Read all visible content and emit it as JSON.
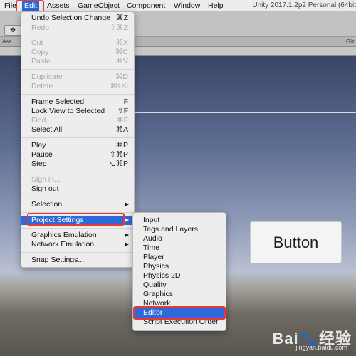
{
  "menubar": {
    "items": [
      {
        "label": "File"
      },
      {
        "label": "Edit"
      },
      {
        "label": "Assets"
      },
      {
        "label": "GameObject"
      },
      {
        "label": "Component"
      },
      {
        "label": "Window"
      },
      {
        "label": "Help"
      }
    ],
    "title": "Unity 2017.1.2p2 Personal (64bit"
  },
  "toolbar": {
    "tabs": {
      "assets": "Ass",
      "gizmos": "Giz"
    }
  },
  "edit_menu": {
    "items": [
      {
        "label": "Undo Selection Change",
        "shortcut": "⌘Z",
        "disabled": false
      },
      {
        "label": "Redo",
        "shortcut": "⇧⌘Z",
        "disabled": true
      },
      {
        "label": "Cut",
        "shortcut": "⌘X",
        "disabled": true
      },
      {
        "label": "Copy",
        "shortcut": "⌘C",
        "disabled": true
      },
      {
        "label": "Paste",
        "shortcut": "⌘V",
        "disabled": true
      },
      {
        "label": "Duplicate",
        "shortcut": "⌘D",
        "disabled": true
      },
      {
        "label": "Delete",
        "shortcut": "⌘⌫",
        "disabled": true
      },
      {
        "label": "Frame Selected",
        "shortcut": "F",
        "disabled": false
      },
      {
        "label": "Lock View to Selected",
        "shortcut": "⇧F",
        "disabled": false
      },
      {
        "label": "Find",
        "shortcut": "⌘F",
        "disabled": true
      },
      {
        "label": "Select All",
        "shortcut": "⌘A",
        "disabled": false
      },
      {
        "label": "Play",
        "shortcut": "⌘P",
        "disabled": false
      },
      {
        "label": "Pause",
        "shortcut": "⇧⌘P",
        "disabled": false
      },
      {
        "label": "Step",
        "shortcut": "⌥⌘P",
        "disabled": false
      },
      {
        "label": "Sign in...",
        "shortcut": "",
        "disabled": true
      },
      {
        "label": "Sign out",
        "shortcut": "",
        "disabled": false
      },
      {
        "label": "Selection",
        "shortcut": "",
        "disabled": false
      },
      {
        "label": "Project Settings",
        "shortcut": "",
        "disabled": false,
        "highlighted": true
      },
      {
        "label": "Graphics Emulation",
        "shortcut": "",
        "disabled": false
      },
      {
        "label": "Network Emulation",
        "shortcut": "",
        "disabled": false
      },
      {
        "label": "Snap Settings...",
        "shortcut": "",
        "disabled": false
      }
    ]
  },
  "project_settings_submenu": {
    "items": [
      {
        "label": "Input"
      },
      {
        "label": "Tags and Layers"
      },
      {
        "label": "Audio"
      },
      {
        "label": "Time"
      },
      {
        "label": "Player"
      },
      {
        "label": "Physics"
      },
      {
        "label": "Physics 2D"
      },
      {
        "label": "Quality"
      },
      {
        "label": "Graphics"
      },
      {
        "label": "Network"
      },
      {
        "label": "Editor",
        "highlighted": true
      },
      {
        "label": "Script Execution Order"
      }
    ]
  },
  "scene": {
    "button_label": "Button"
  },
  "watermark": {
    "brand": "Bai🐾经验",
    "url": "jingyan.baidu.com"
  },
  "colors": {
    "highlight": "#2f68d8",
    "annotation_box": "#e53935"
  }
}
